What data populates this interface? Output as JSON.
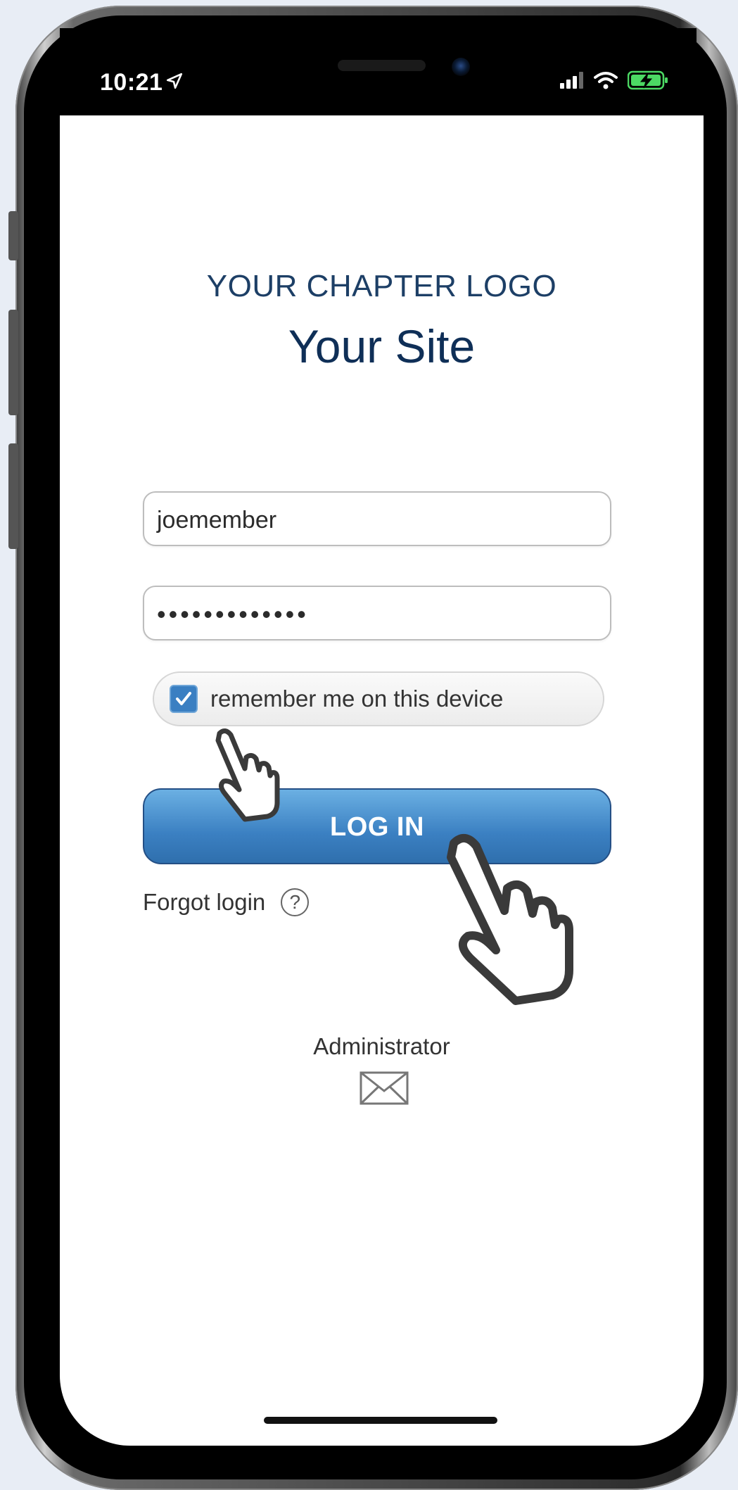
{
  "status_bar": {
    "time": "10:21",
    "icons": [
      "location-arrow-icon",
      "cellular-signal-icon",
      "wifi-icon",
      "battery-charging-icon"
    ]
  },
  "header": {
    "logo_text": "YOUR CHAPTER LOGO",
    "site_title": "Your Site"
  },
  "login_form": {
    "username_value": "joemember",
    "password_value": "•••••••••••••",
    "remember_label": "remember me on this device",
    "remember_checked": true,
    "login_button_label": "LOG IN",
    "forgot_label": "Forgot login",
    "help_symbol": "?"
  },
  "footer": {
    "admin_label": "Administrator",
    "contact_icon": "envelope-icon"
  },
  "colors": {
    "title_navy": "#0f2f57",
    "button_blue": "#3b80c2",
    "checkbox_blue": "#3a7fc2",
    "battery_green": "#4cd964"
  }
}
